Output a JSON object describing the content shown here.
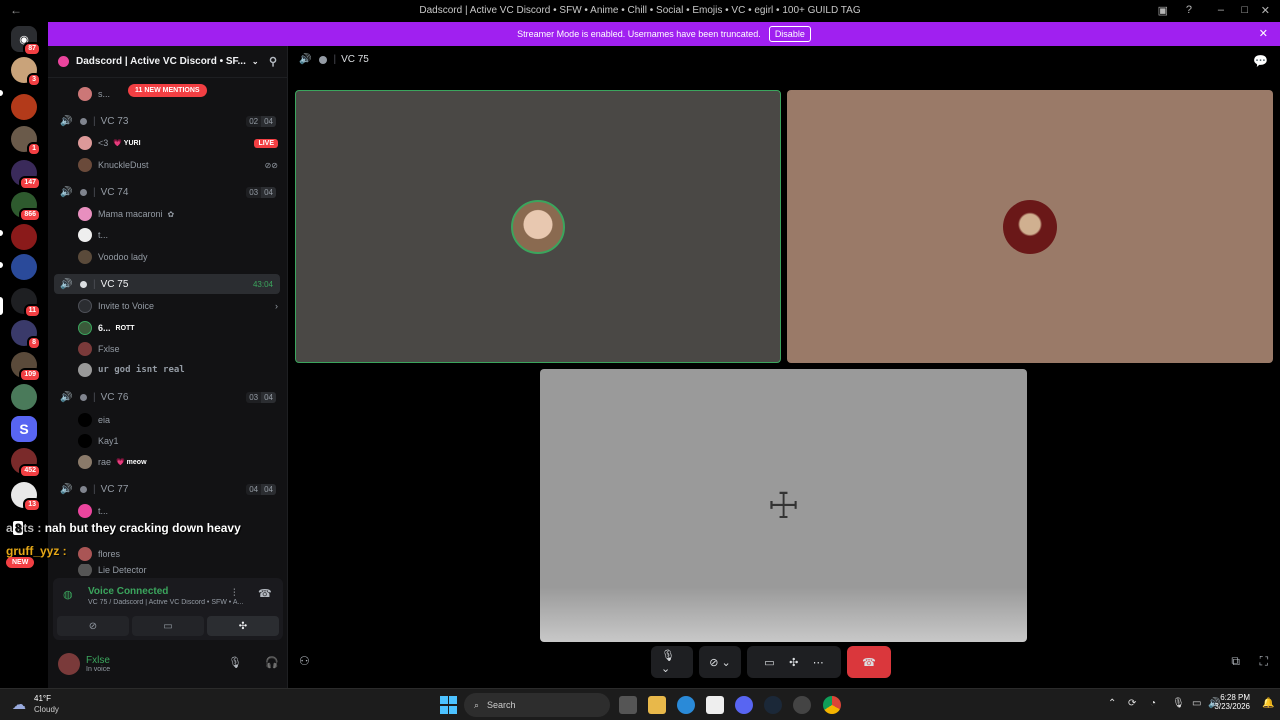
{
  "window": {
    "title": "Dadscord | Active VC Discord • SFW • Anime • Chill • Social • Emojis • VC • egirl • 100+ GUILD TAG"
  },
  "rail_badges": [
    "87",
    "3",
    "1",
    "147",
    "866",
    "11",
    "8",
    "109",
    "452",
    "13"
  ],
  "banner": {
    "text": "Streamer Mode is enabled. Usernames have been truncated.",
    "disable_label": "Disable"
  },
  "guild": {
    "name": "Dadscord | Active VC Discord • SF...",
    "mentions": "11 NEW MENTIONS",
    "top_user": "s..."
  },
  "channels": {
    "vc73": {
      "name": "VC 73",
      "a": "02",
      "b": "04"
    },
    "vc74": {
      "name": "VC 74",
      "a": "03",
      "b": "04"
    },
    "vc75": {
      "name": "VC 75",
      "a": "43:04"
    },
    "vc76": {
      "name": "VC 76",
      "a": "03",
      "b": "04"
    },
    "vc77": {
      "name": "VC 77",
      "a": "04",
      "b": "04"
    }
  },
  "users": {
    "u73a": "<3",
    "u73a_tag": "💗 YURI",
    "live": "LIVE",
    "u73b": "KnuckleDust",
    "u74a": "Mama macaroni",
    "u74b": "t...",
    "u74c": "Voodoo lady",
    "invite": "Invite to Voice",
    "u75a": "6...",
    "u75a_tag": "ROTT",
    "u75b": "Fxlse",
    "u75c": "ur god isnt real",
    "u76a": "eia",
    "u76b": "Kay1",
    "u76c": "rae",
    "u76c_tag": "💗 meow",
    "u77a": "t...",
    "u77b": "flores",
    "u77c": "Lie Detector"
  },
  "voice": {
    "title": "Voice Connected",
    "subtitle": "VC 75 / Dadscord | Active VC Discord • SFW • A..."
  },
  "me": {
    "name": "Fxlse",
    "status": "In voice"
  },
  "main": {
    "channel": "VC 75"
  },
  "overlay": {
    "msg": "nah but they cracking down heavy",
    "user": "gruff_yyz :",
    "new": "NEW"
  },
  "taskbar": {
    "weather_temp": "41°F",
    "weather_desc": "Cloudy",
    "search": "Search",
    "time": "6:28 PM",
    "date": "3/23/2026"
  }
}
